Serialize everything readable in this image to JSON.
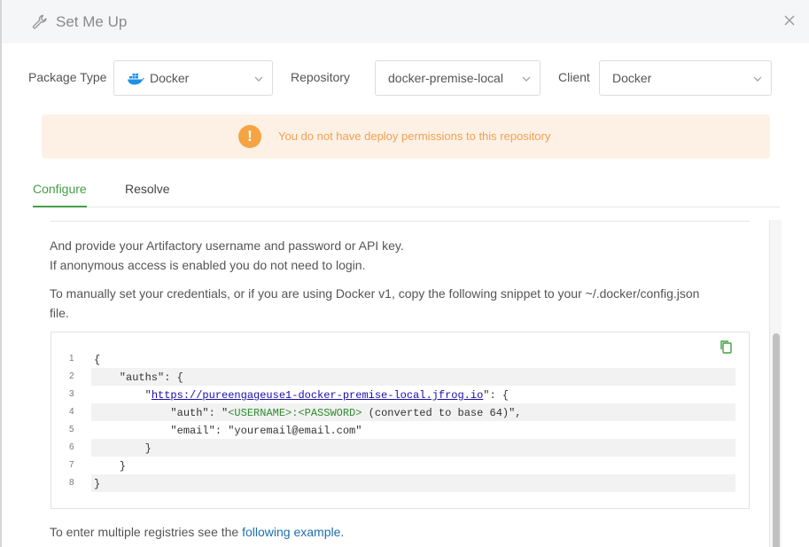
{
  "header": {
    "title": "Set Me Up",
    "icon": "wrench-icon"
  },
  "selectors": {
    "package_type_label": "Package Type",
    "package_type_value": "Docker",
    "repository_label": "Repository",
    "repository_value": "docker-premise-local",
    "client_label": "Client",
    "client_value": "Docker"
  },
  "warning": {
    "icon": "exclamation-icon",
    "message": "You do not have deploy permissions to this repository",
    "color": "#f5a443"
  },
  "tabs": [
    {
      "label": "Configure",
      "active": true
    },
    {
      "label": "Resolve",
      "active": false
    }
  ],
  "content": {
    "line1": "And provide your Artifactory username and password or API key.",
    "line2": "If anonymous access is enabled you do not need to login.",
    "line3a": "To manually set your credentials, or if you are using Docker v1, copy the following snippet to your ~/.docker/config.json",
    "line3b": "file.",
    "footer_text": "To enter multiple registries see the ",
    "footer_link": "following example",
    "footer_end": "."
  },
  "code": {
    "lines": [
      {
        "n": "1",
        "t": "{"
      },
      {
        "n": "2",
        "t": "    \"auths\": {"
      },
      {
        "n": "3",
        "pre": "        \"",
        "url": "https://pureengageuse1-docker-premise-local.jfrog.io",
        "post": "\": {"
      },
      {
        "n": "4",
        "pre": "            \"auth\": \"",
        "g": "<USERNAME>:<PASSWORD>",
        "post": " (converted to base 64)\","
      },
      {
        "n": "5",
        "t": "            \"email\": \"youremail@email.com\""
      },
      {
        "n": "6",
        "t": "        }"
      },
      {
        "n": "7",
        "t": "    }"
      },
      {
        "n": "8",
        "t": "}"
      }
    ]
  },
  "colors": {
    "accent": "#43a047",
    "link": "#1e6fb0",
    "warning_bg": "#fdf1e6"
  }
}
